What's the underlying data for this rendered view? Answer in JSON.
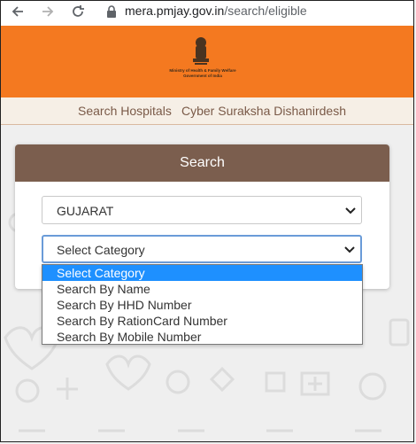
{
  "browser": {
    "url_host": "mera.pmjay.gov.in",
    "url_path": "/search/eligible"
  },
  "header": {
    "ministry_line1": "Ministry of Health & Family Welfare",
    "ministry_line2": "Government of India"
  },
  "nav": {
    "links": [
      "Search Hospitals",
      "Cyber Suraksha Dishanirdesh"
    ]
  },
  "search_card": {
    "title": "Search",
    "state_value": "GUJARAT",
    "category_value": "Select Category",
    "category_options": [
      "Select Category",
      "Search By Name",
      "Search By HHD Number",
      "Search By RationCard Number",
      "Search By Mobile Number"
    ]
  },
  "colors": {
    "header_orange": "#f47920",
    "card_header_brown": "#7b5e4e",
    "selected_option_blue": "#1e90ff",
    "focus_border": "#6a9bd8"
  }
}
